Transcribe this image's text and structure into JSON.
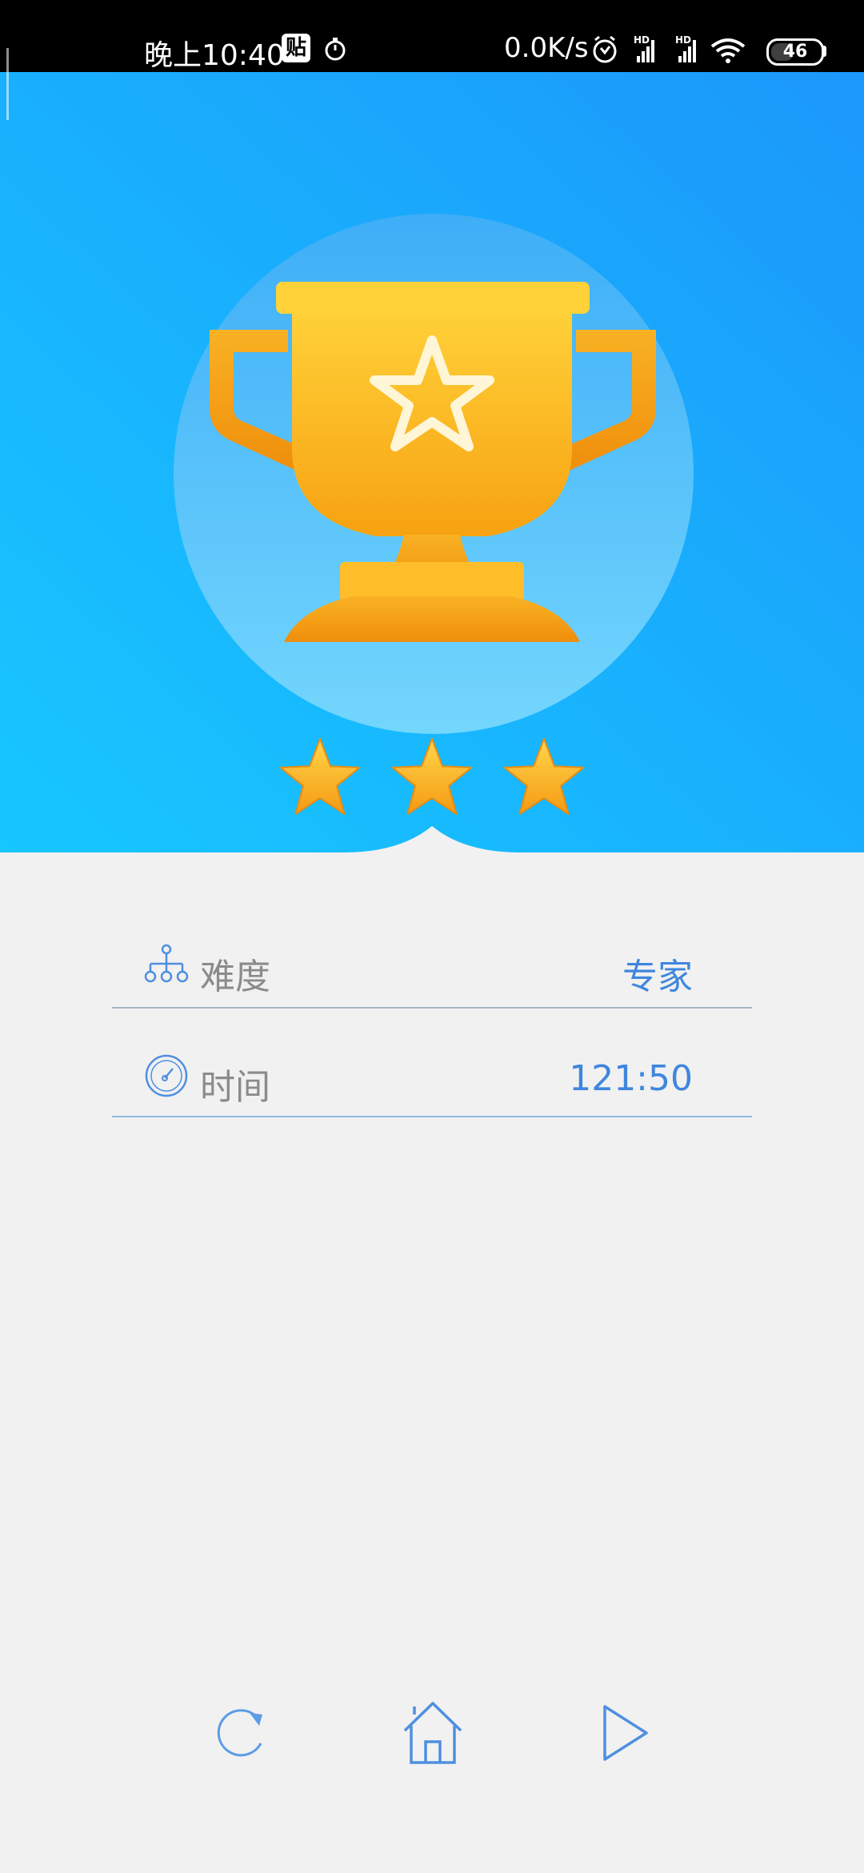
{
  "status_bar": {
    "time": "晚上10:40",
    "pill_label": "贴",
    "net_speed": "0.0K/s",
    "hd1": "HD",
    "hd2": "HD",
    "battery": "46",
    "battery_level_percent": 46
  },
  "header": {
    "trophy_icon": "trophy-icon",
    "stars_earned": 3,
    "stars_total": 3,
    "bg_colors": [
      "#1da3f7",
      "#15b8ff"
    ],
    "accent": "#f8a613"
  },
  "info": {
    "difficulty_label": "难度",
    "difficulty_value": "专家",
    "difficulty_icon": "hierarchy-icon",
    "time_label": "时间",
    "time_value": "121:50",
    "time_icon": "speedometer-icon"
  },
  "controls": {
    "restart_icon": "restart-icon",
    "home_icon": "home-icon",
    "next_icon": "play-icon"
  },
  "colors": {
    "value_blue": "#3f86de",
    "label_grey": "#8b8b8b",
    "icon_blue": "#4f8fe0",
    "background": "#f1f1f1"
  }
}
